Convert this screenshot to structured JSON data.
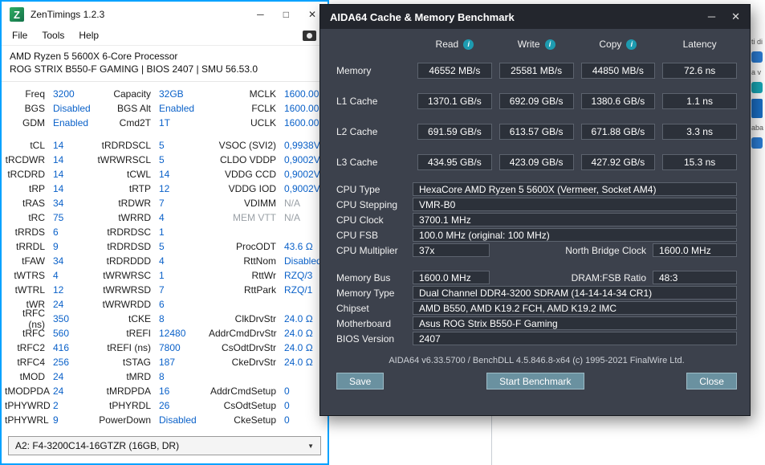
{
  "icons": {
    "minimize": "─",
    "maximize": "□",
    "close": "✕",
    "caret_down": "▼",
    "info": "i"
  },
  "background": {
    "frag1": "ti di",
    "frag2": "a v",
    "frag3": "aba"
  },
  "zentimings": {
    "app_icon_letter": "Z",
    "title": "ZenTimings 1.2.3",
    "menu": [
      "File",
      "Tools",
      "Help"
    ],
    "cpu_line1": "AMD Ryzen 5 5600X 6-Core Processor",
    "cpu_line2": "ROG STRIX B550-F GAMING | BIOS 2407 | SMU 56.53.0",
    "top_col1": [
      {
        "l": "Freq",
        "v": "3200"
      },
      {
        "l": "BGS",
        "v": "Disabled"
      },
      {
        "l": "GDM",
        "v": "Enabled"
      }
    ],
    "top_col2": [
      {
        "l": "Capacity",
        "v": "32GB"
      },
      {
        "l": "BGS Alt",
        "v": "Enabled"
      },
      {
        "l": "Cmd2T",
        "v": "1T"
      }
    ],
    "top_col3": [
      {
        "l": "MCLK",
        "v": "1600.00"
      },
      {
        "l": "FCLK",
        "v": "1600.00"
      },
      {
        "l": "UCLK",
        "v": "1600.00"
      }
    ],
    "main_col1": [
      {
        "l": "tCL",
        "v": "14"
      },
      {
        "l": "tRCDWR",
        "v": "14"
      },
      {
        "l": "tRCDRD",
        "v": "14"
      },
      {
        "l": "tRP",
        "v": "14"
      },
      {
        "l": "tRAS",
        "v": "34"
      },
      {
        "l": "tRC",
        "v": "75"
      },
      {
        "l": "tRRDS",
        "v": "6"
      },
      {
        "l": "tRRDL",
        "v": "9"
      },
      {
        "l": "tFAW",
        "v": "34"
      },
      {
        "l": "tWTRS",
        "v": "4"
      },
      {
        "l": "tWTRL",
        "v": "12"
      },
      {
        "l": "tWR",
        "v": "24"
      },
      {
        "l": "tRFC (ns)",
        "v": "350"
      },
      {
        "l": "tRFC",
        "v": "560"
      },
      {
        "l": "tRFC2",
        "v": "416"
      },
      {
        "l": "tRFC4",
        "v": "256"
      },
      {
        "l": "tMOD",
        "v": "24"
      },
      {
        "l": "tMODPDA",
        "v": "24"
      },
      {
        "l": "tPHYWRD",
        "v": "2"
      },
      {
        "l": "tPHYWRL",
        "v": "9"
      }
    ],
    "main_col2": [
      {
        "l": "tRDRDSCL",
        "v": "5"
      },
      {
        "l": "tWRWRSCL",
        "v": "5"
      },
      {
        "l": "tCWL",
        "v": "14"
      },
      {
        "l": "tRTP",
        "v": "12"
      },
      {
        "l": "tRDWR",
        "v": "7"
      },
      {
        "l": "tWRRD",
        "v": "4"
      },
      {
        "l": "tRDRDSC",
        "v": "1"
      },
      {
        "l": "tRDRDSD",
        "v": "5"
      },
      {
        "l": "tRDRDDD",
        "v": "4"
      },
      {
        "l": "tWRWRSC",
        "v": "1"
      },
      {
        "l": "tWRWRSD",
        "v": "7"
      },
      {
        "l": "tWRWRDD",
        "v": "6"
      },
      {
        "l": "tCKE",
        "v": "8"
      },
      {
        "l": "tREFI",
        "v": "12480"
      },
      {
        "l": "tREFI (ns)",
        "v": "7800"
      },
      {
        "l": "tSTAG",
        "v": "187"
      },
      {
        "l": "tMRD",
        "v": "8"
      },
      {
        "l": "tMRDPDA",
        "v": "16"
      },
      {
        "l": "tPHYRDL",
        "v": "26"
      },
      {
        "l": "PowerDown",
        "v": "Disabled"
      }
    ],
    "main_col3": [
      {
        "l": "VSOC (SVI2)",
        "v": "0,9938V"
      },
      {
        "l": "CLDO VDDP",
        "v": "0,9002V"
      },
      {
        "l": "VDDG CCD",
        "v": "0,9002V"
      },
      {
        "l": "VDDG IOD",
        "v": "0,9002V"
      },
      {
        "l": "VDIMM",
        "v": "N/A",
        "m": true
      },
      {
        "l": "MEM VTT",
        "v": "N/A",
        "m": true,
        "lm": true
      },
      {
        "l": "",
        "v": ""
      },
      {
        "l": "ProcODT",
        "v": "43.6 Ω"
      },
      {
        "l": "RttNom",
        "v": "Disabled"
      },
      {
        "l": "RttWr",
        "v": "RZQ/3"
      },
      {
        "l": "RttPark",
        "v": "RZQ/1"
      },
      {
        "l": "",
        "v": ""
      },
      {
        "l": "ClkDrvStr",
        "v": "24.0 Ω"
      },
      {
        "l": "AddrCmdDrvStr",
        "v": "24.0 Ω"
      },
      {
        "l": "CsOdtDrvStr",
        "v": "24.0 Ω"
      },
      {
        "l": "CkeDrvStr",
        "v": "24.0 Ω"
      },
      {
        "l": "",
        "v": ""
      },
      {
        "l": "AddrCmdSetup",
        "v": "0"
      },
      {
        "l": "CsOdtSetup",
        "v": "0"
      },
      {
        "l": "CkeSetup",
        "v": "0"
      }
    ],
    "dropdown": "A2: F4-3200C14-16GTZR (16GB, DR)"
  },
  "aida": {
    "title": "AIDA64 Cache & Memory Benchmark",
    "headers": [
      {
        "label": "Read",
        "info": true
      },
      {
        "label": "Write",
        "info": true
      },
      {
        "label": "Copy",
        "info": true
      },
      {
        "label": "Latency",
        "info": false
      }
    ],
    "bench_rows": [
      {
        "label": "Memory",
        "read": "46552 MB/s",
        "write": "25581 MB/s",
        "copy": "44850 MB/s",
        "latency": "72.6 ns"
      },
      {
        "label": "L1 Cache",
        "read": "1370.1 GB/s",
        "write": "692.09 GB/s",
        "copy": "1380.6 GB/s",
        "latency": "1.1 ns"
      },
      {
        "label": "L2 Cache",
        "read": "691.59 GB/s",
        "write": "613.57 GB/s",
        "copy": "671.88 GB/s",
        "latency": "3.3 ns"
      },
      {
        "label": "L3 Cache",
        "read": "434.95 GB/s",
        "write": "423.09 GB/s",
        "copy": "427.92 GB/s",
        "latency": "15.3 ns"
      }
    ],
    "info": {
      "cpu_type": {
        "label": "CPU Type",
        "value": "HexaCore AMD Ryzen 5 5600X  (Vermeer, Socket AM4)"
      },
      "cpu_stepping": {
        "label": "CPU Stepping",
        "value": "VMR-B0"
      },
      "cpu_clock": {
        "label": "CPU Clock",
        "value": "3700.1 MHz"
      },
      "cpu_fsb": {
        "label": "CPU FSB",
        "value": "100.0 MHz  (original: 100 MHz)"
      },
      "cpu_multiplier": {
        "label": "CPU Multiplier",
        "value": "37x"
      },
      "north_bridge": {
        "label": "North Bridge Clock",
        "value": "1600.0 MHz"
      },
      "memory_bus": {
        "label": "Memory Bus",
        "value": "1600.0 MHz"
      },
      "dram_fsb": {
        "label": "DRAM:FSB Ratio",
        "value": "48:3"
      },
      "memory_type": {
        "label": "Memory Type",
        "value": "Dual Channel DDR4-3200 SDRAM  (14-14-14-34 CR1)"
      },
      "chipset": {
        "label": "Chipset",
        "value": "AMD B550, AMD K19.2 FCH, AMD K19.2 IMC"
      },
      "motherboard": {
        "label": "Motherboard",
        "value": "Asus ROG Strix B550-F Gaming"
      },
      "bios": {
        "label": "BIOS Version",
        "value": "2407"
      }
    },
    "footer": "AIDA64 v6.33.5700 / BenchDLL 4.5.846.8-x64 (c) 1995-2021 FinalWire Ltd.",
    "buttons": {
      "save": "Save",
      "start": "Start Benchmark",
      "close": "Close"
    }
  }
}
